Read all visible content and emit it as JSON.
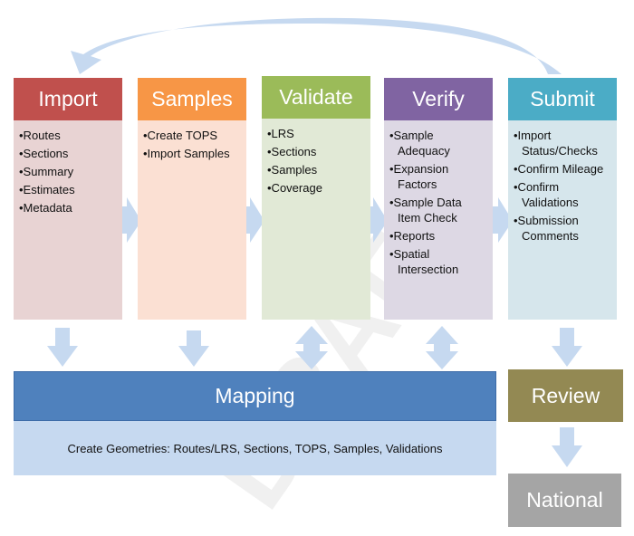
{
  "watermark": "DRAFT",
  "steps": [
    {
      "title": "Import",
      "color": "#c0504d",
      "bg": "#e8d3d3",
      "items": [
        "•Routes",
        "•Sections",
        "•Summary",
        "•Estimates",
        "•Metadata"
      ]
    },
    {
      "title": "Samples",
      "color": "#f79646",
      "bg": "#fbe0d3",
      "items": [
        "•Create TOPS",
        "•Import Samples"
      ]
    },
    {
      "title": "Validate",
      "color": "#9bbb59",
      "bg": "#e1e9d6",
      "items": [
        "•LRS",
        "•Sections",
        "•Samples",
        "•Coverage"
      ]
    },
    {
      "title": "Verify",
      "color": "#8064a2",
      "bg": "#ddd8e4",
      "items": [
        "•Sample Adequacy",
        "•Expansion Factors",
        "•Sample Data Item Check",
        "•Reports",
        "•Spatial Intersection"
      ]
    },
    {
      "title": "Submit",
      "color": "#4bacc6",
      "bg": "#d6e6ec",
      "items": [
        "•Import Status/Checks",
        "•Confirm Mileage",
        "•Confirm Validations",
        "•Submission Comments"
      ]
    }
  ],
  "mapping": {
    "title": "Mapping",
    "description": "Create Geometries: Routes/LRS, Sections, TOPS, Samples, Validations",
    "color": "#4f81bd",
    "bg": "#c6d9f0"
  },
  "review": {
    "title": "Review",
    "color": "#938953"
  },
  "national": {
    "title": "National",
    "color": "#a5a5a5"
  },
  "arrow_color": "#c6d9f0"
}
